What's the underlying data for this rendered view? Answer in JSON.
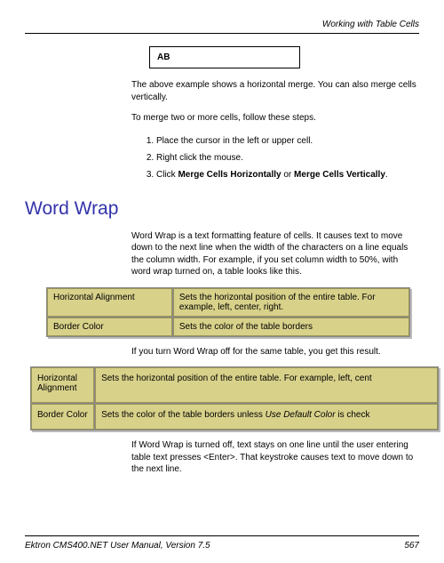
{
  "header": {
    "section_title": "Working with Table Cells"
  },
  "example": {
    "ab": "AB"
  },
  "body": {
    "p1": "The above example shows a horizontal merge. You can also merge cells vertically.",
    "p2": "To merge two or more cells, follow these steps.",
    "steps": {
      "s1": "Place the cursor in the left or upper cell.",
      "s2": "Right click the mouse.",
      "s3_prefix": "Click ",
      "s3_bold_a": "Merge Cells Horizontally",
      "s3_or": " or ",
      "s3_bold_b": "Merge Cells Vertically",
      "s3_period": "."
    },
    "heading": "Word Wrap",
    "ww_intro": "Word Wrap is a text formatting feature of cells. It causes text to move down to the next line when the width of the characters on a line equals the column width. For example, if you set column width to 50%, with word wrap turned on, a table looks like this.",
    "ww_mid": "If you turn Word Wrap off for the same table, you get this result.",
    "ww_out": "If Word Wrap is turned off, text stays on one line until the user entering table text presses <Enter>. That keystroke causes text to move down to the next line."
  },
  "table1": {
    "r0c0": "Horizontal Alignment",
    "r0c1": "Sets the horizontal position of the entire table. For example, left, center, right.",
    "r1c0": "Border Color",
    "r1c1": "Sets the color of the table borders"
  },
  "table2": {
    "r0c0": "Horizontal Alignment",
    "r0c1": "Sets the horizontal position of the entire table. For example, left, cent",
    "r1c0": "Border Color",
    "r1c1_a": "Sets the color of the table borders unless ",
    "r1c1_i": "Use Default Color",
    "r1c1_b": " is check"
  },
  "footer": {
    "left": "Ektron CMS400.NET User Manual, Version 7.5",
    "right": "567"
  }
}
